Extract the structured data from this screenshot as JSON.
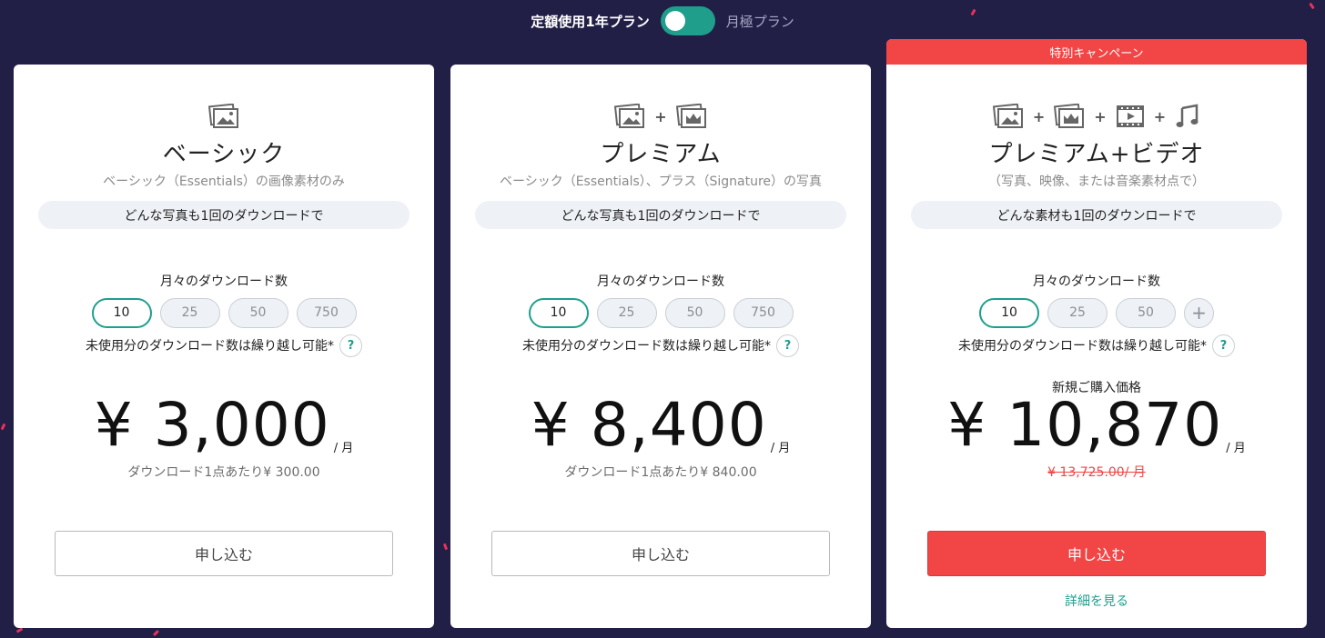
{
  "billing_toggle": {
    "annual_label": "定額使用1年プラン",
    "monthly_label": "月極プラン",
    "selected": "annual"
  },
  "colors": {
    "background": "#221f47",
    "accent_teal": "#1f9e8c",
    "campaign_red": "#f24545"
  },
  "plans": [
    {
      "icons": [
        "photo-icon"
      ],
      "title": "ベーシック",
      "subtitle": "ベーシック（Essentials）の画像素材のみ",
      "note": "どんな写真も1回のダウンロードで",
      "downloads_heading": "月々のダウンロード数",
      "quantities": [
        "10",
        "25",
        "50",
        "750"
      ],
      "selected_quantity": "10",
      "rollover_text": "未使用分のダウンロード数は繰り越し可能*",
      "help_label": "?",
      "price": "¥ 3,000",
      "per_month": "/ 月",
      "per_download": "ダウンロード1点あたり¥ 300.00",
      "apply_label": "申し込む"
    },
    {
      "icons": [
        "photo-icon",
        "premium-photo-icon"
      ],
      "plus": "+",
      "title": "プレミアム",
      "subtitle": "ベーシック（Essentials）、プラス（Signature）の写真",
      "note": "どんな写真も1回のダウンロードで",
      "downloads_heading": "月々のダウンロード数",
      "quantities": [
        "10",
        "25",
        "50",
        "750"
      ],
      "selected_quantity": "10",
      "rollover_text": "未使用分のダウンロード数は繰り越し可能*",
      "help_label": "?",
      "price": "¥ 8,400",
      "per_month": "/ 月",
      "per_download": "ダウンロード1点あたり¥ 840.00",
      "apply_label": "申し込む"
    },
    {
      "ribbon": "特別キャンペーン",
      "icons": [
        "photo-icon",
        "premium-photo-icon",
        "video-icon",
        "music-icon"
      ],
      "plus": "+",
      "title": "プレミアム+ビデオ",
      "subtitle": "（写真、映像、または音楽素材点で）",
      "note": "どんな素材も1回のダウンロードで",
      "downloads_heading": "月々のダウンロード数",
      "quantities": [
        "10",
        "25",
        "50"
      ],
      "more_quantity": "+",
      "selected_quantity": "10",
      "rollover_text": "未使用分のダウンロード数は繰り越し可能*",
      "help_label": "?",
      "new_purchase_label": "新規ご購入価格",
      "price": "¥ 10,870",
      "per_month": "/ 月",
      "old_price": "¥ 13,725.00/ 月",
      "apply_label": "申し込む",
      "details_link": "詳細を見る"
    }
  ]
}
